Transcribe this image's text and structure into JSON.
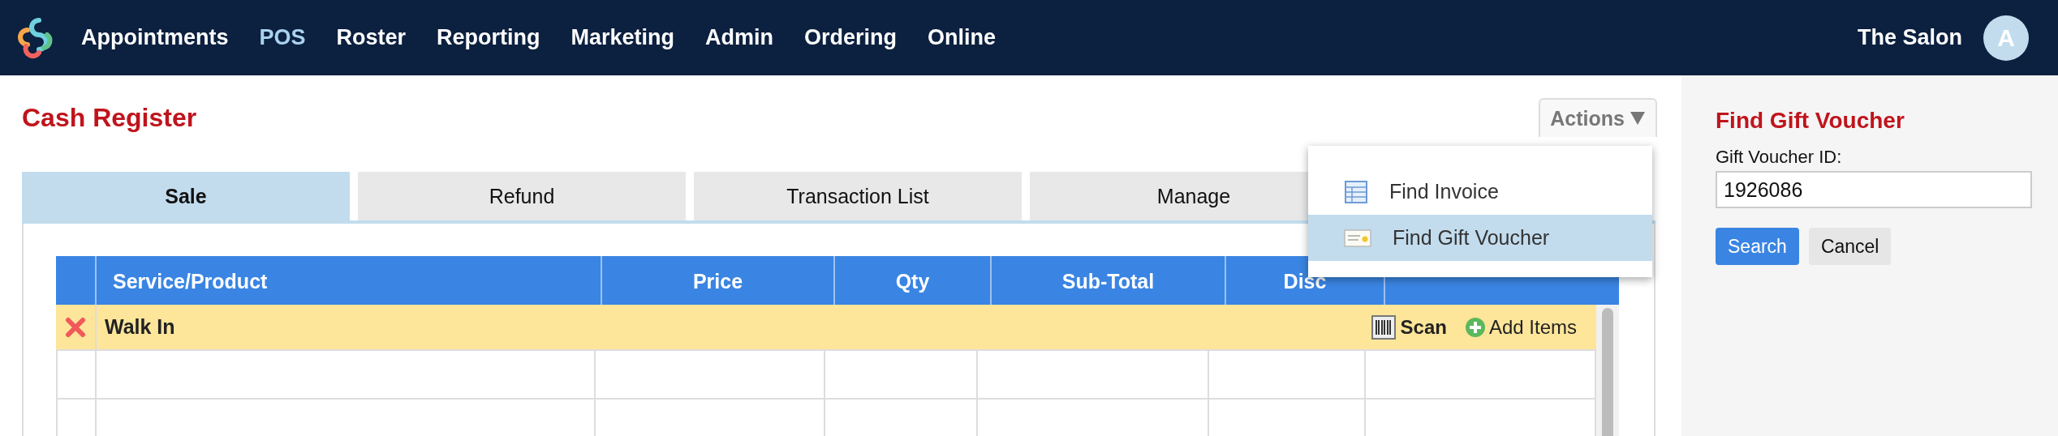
{
  "nav": {
    "items": [
      {
        "label": "Appointments",
        "selected": false
      },
      {
        "label": "POS",
        "selected": true
      },
      {
        "label": "Roster",
        "selected": false
      },
      {
        "label": "Reporting",
        "selected": false
      },
      {
        "label": "Marketing",
        "selected": false
      },
      {
        "label": "Admin",
        "selected": false
      },
      {
        "label": "Ordering",
        "selected": false
      },
      {
        "label": "Online",
        "selected": false
      }
    ],
    "account": "The Salon",
    "avatar": "A"
  },
  "page": {
    "title": "Cash Register",
    "actions": "Actions"
  },
  "tabs": [
    {
      "label": "Sale",
      "selected": true
    },
    {
      "label": "Refund",
      "selected": false
    },
    {
      "label": "Transaction List",
      "selected": false
    },
    {
      "label": "Manage",
      "selected": false
    }
  ],
  "table": {
    "columns": [
      "Service/Product",
      "Price",
      "Qty",
      "Sub-Total",
      "Disc"
    ],
    "client_row": {
      "name": "Walk In",
      "scan": "Scan",
      "add": "Add Items"
    }
  },
  "menu": {
    "items": [
      {
        "label": "Find Invoice",
        "kind": "invoice",
        "selected": false
      },
      {
        "label": "Find Gift Voucher",
        "kind": "voucher",
        "selected": true
      }
    ]
  },
  "panel": {
    "title": "Find Gift Voucher",
    "label": "Gift Voucher ID:",
    "value": "1926086",
    "buttons": [
      {
        "label": "Search",
        "kind": "primary"
      },
      {
        "label": "Cancel",
        "kind": "secondary"
      }
    ]
  }
}
